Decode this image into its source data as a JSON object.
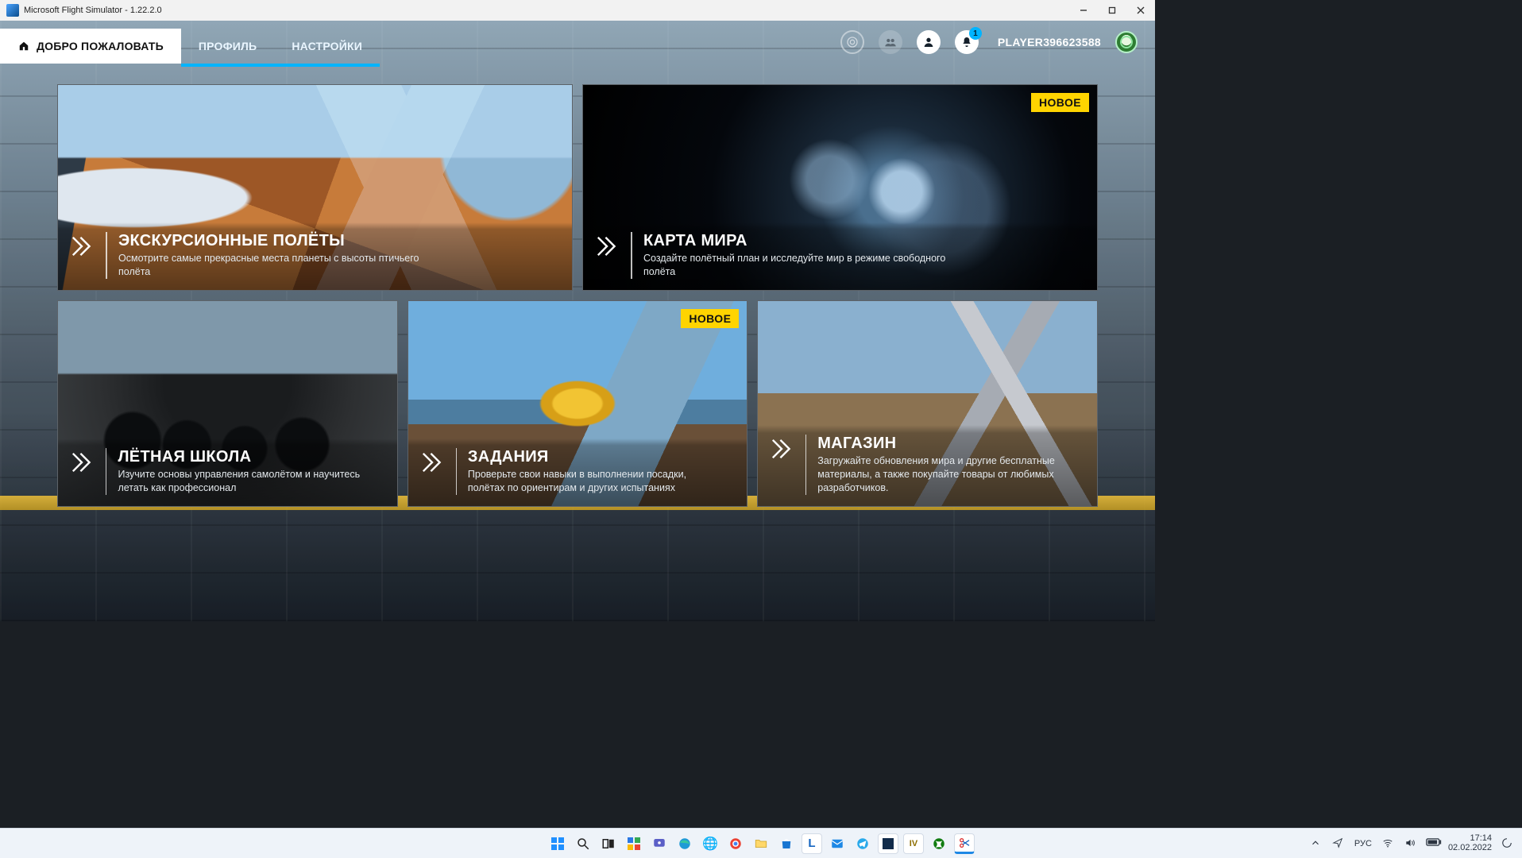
{
  "window": {
    "title": "Microsoft Flight Simulator - 1.22.2.0"
  },
  "nav": {
    "tabs": [
      {
        "label": "ДОБРО ПОЖАЛОВАТЬ",
        "active": true,
        "icon": "home"
      },
      {
        "label": "ПРОФИЛЬ",
        "active": false
      },
      {
        "label": "НАСТРОЙКИ",
        "active": false
      }
    ],
    "notifications_count": "1",
    "player_name": "PLAYER396623588"
  },
  "badges": {
    "new_label": "НОВОЕ"
  },
  "cards": {
    "tours": {
      "title": "ЭКСКУРСИОННЫЕ ПОЛЁТЫ",
      "desc": "Осмотрите самые прекрасные места планеты с высоты птичьего полёта"
    },
    "worldmap": {
      "title": "КАРТА МИРА",
      "desc": "Создайте полётный план и исследуйте мир в режиме свободного полёта",
      "new": true
    },
    "school": {
      "title": "ЛЁТНАЯ ШКОЛА",
      "desc": "Изучите основы управления самолётом и научитесь летать как профессионал"
    },
    "tasks": {
      "title": "ЗАДАНИЯ",
      "desc": "Проверьте свои навыки в выполнении посадки, полётах по ориентирам и других испытаниях",
      "new": true
    },
    "shop": {
      "title": "МАГАЗИН",
      "desc": "Загружайте обновления мира и другие бесплатные материалы, а также покупайте товары от любимых разработчиков."
    }
  },
  "taskbar": {
    "lang": "РУС",
    "time": "17:14",
    "date": "02.02.2022"
  }
}
